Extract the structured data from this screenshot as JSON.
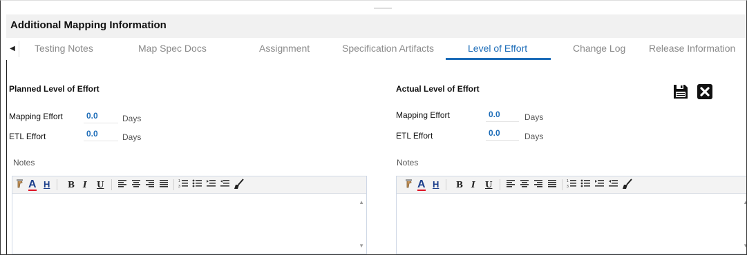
{
  "header": {
    "title": "Additional Mapping Information"
  },
  "tabs": [
    {
      "label": "Testing Notes",
      "active": false
    },
    {
      "label": "Map Spec Docs",
      "active": false
    },
    {
      "label": "Assignment",
      "active": false
    },
    {
      "label": "Specification Artifacts",
      "active": false
    },
    {
      "label": "Level of Effort",
      "active": true
    },
    {
      "label": "Change Log",
      "active": false
    },
    {
      "label": "Release Information",
      "active": false
    }
  ],
  "planned": {
    "title": "Planned Level of Effort",
    "mapping_label": "Mapping Effort",
    "mapping_value": "0.0",
    "mapping_unit": "Days",
    "etl_label": "ETL Effort",
    "etl_value": "0.0",
    "etl_unit": "Days",
    "notes_label": "Notes"
  },
  "actual": {
    "title": "Actual Level of Effort",
    "mapping_label": "Mapping Effort",
    "mapping_value": "0.0",
    "mapping_unit": "Days",
    "etl_label": "ETL Effort",
    "etl_value": "0.0",
    "etl_unit": "Days",
    "notes_label": "Notes"
  },
  "toolbar": {
    "bold": "B",
    "italic": "I",
    "underline": "U",
    "icons": [
      "text-color-icon",
      "highlight-icon",
      "bold-icon",
      "italic-icon",
      "underline-icon",
      "align-left-icon",
      "align-center-icon",
      "align-right-icon",
      "align-justify-icon",
      "numbered-list-icon",
      "bulleted-list-icon",
      "indent-icon",
      "outdent-icon",
      "clear-format-icon"
    ]
  },
  "actions": {
    "icons": [
      "save-icon",
      "close-icon"
    ]
  },
  "colors": {
    "accent": "#1c6cb8",
    "header_bg": "#f1f1f1"
  }
}
